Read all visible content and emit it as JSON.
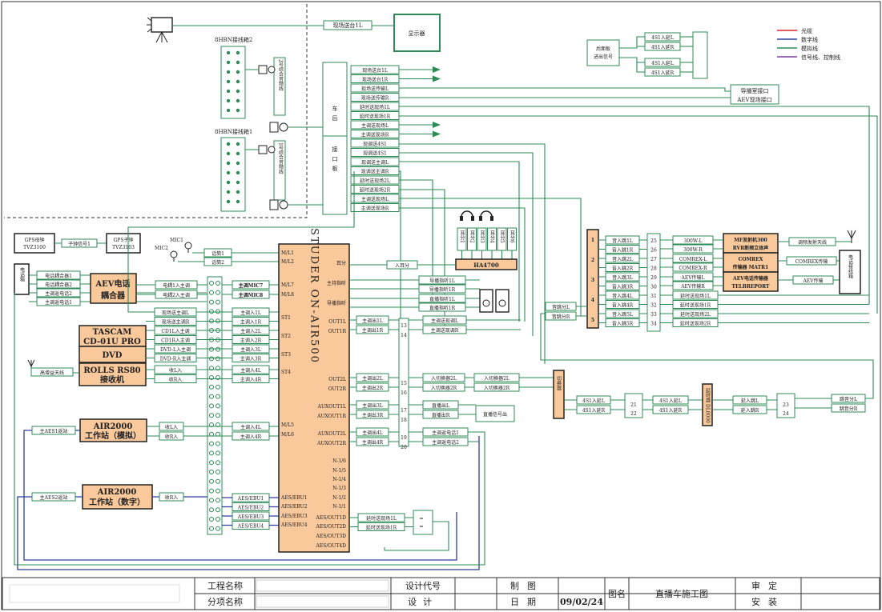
{
  "legend": [
    {
      "label": "光缆",
      "color": "#d62728"
    },
    {
      "label": "数字线",
      "color": "#2f3e9e"
    },
    {
      "label": "模拟线",
      "color": "#2e8b57"
    },
    {
      "label": "信号线、控制线",
      "color": "#7b3fa0"
    }
  ],
  "top": {
    "monitor_cable": "现场送台1L",
    "monitor": "显示器",
    "box2": "8HBN接线箱2",
    "box1": "8HBN接线箱1",
    "cable2": "2号综合音频线",
    "cable1": "1号综合音频线"
  },
  "rear_panel": {
    "title": "后面板进出信号",
    "labels": [
      "4S1入延L",
      "4S1入延R",
      "4S1入延L",
      "4S1入延R"
    ]
  },
  "panel": {
    "t1": "车",
    "t2": "后",
    "t3": "接",
    "t4": "口",
    "t5": "板",
    "rows": [
      "现场送台1L",
      "现场送台1R",
      "现场送传输L",
      "现场送传输R",
      "延时送现场1L",
      "延时送现场1R",
      "主调送现场L",
      "主调送现场R",
      "现调送4S1",
      "现调送4S1",
      "现调送主调L",
      "现调送主调R",
      "延时送现场2L",
      "延时送现场2R",
      "主调送现场L",
      "主调送现场R"
    ]
  },
  "guide": {
    "label1": "导播室接口",
    "label2": "AEV现场接口"
  },
  "gps": {
    "mother": "GPS母钟",
    "mother_model": "TVZ3100",
    "sub_signal": "子钟信号1",
    "child": "GPS子钟",
    "child_model": "TVZ3103"
  },
  "mics": {
    "mic1": "MIC1",
    "mic2": "MIC2",
    "label1": "话筒1",
    "label2": "话筒2"
  },
  "phone": {
    "box": "电话箱",
    "rows": [
      "电话耦合器1",
      "电话耦合器2",
      "主调返电话2",
      "主调返电话1"
    ]
  },
  "aev": {
    "l1": "AEV电话",
    "l2": "耦合器",
    "out1": "电耦1入主调",
    "out2": "电耦2入主调",
    "m1": "主调MIC7",
    "m2": "主调MIC8"
  },
  "sources": {
    "rows": [
      "现场送主调L",
      "现场送主调R",
      "CD1L入主调",
      "CD1R入主调",
      "DVD-L入主调",
      "DVD-R入主调",
      "收L入",
      "收R入"
    ],
    "mains": [
      "主调入1L",
      "主调入1R",
      "主调入2L",
      "主调入2R",
      "主调入3L",
      "主调入3R",
      "主调入4L",
      "主调入4R"
    ],
    "tascam1": "TASCAM",
    "tascam2": "CD-01U PRO",
    "dvd": "DVD",
    "rolls1": "ROLLS RS80",
    "rolls2": "接收机",
    "antenna": "高增益天线"
  },
  "air1": {
    "l1": "AIR2000",
    "l2": "工作站（模拟）",
    "in": "主AES1返站",
    "r1": "收L入",
    "r2": "收R入",
    "m1": "主调入4L",
    "m2": "主调入4R"
  },
  "air2": {
    "l1": "AIR2000",
    "l2": "工作站（数字）",
    "in": "主AES2返站",
    "r1": "收R入"
  },
  "aes": {
    "rows": [
      "AES/EBU1",
      "AES/EBU2",
      "AES/EBU3",
      "AES/EBU4"
    ]
  },
  "studer": {
    "title": "STUDER ON-AIR500",
    "left": [
      "M/L1",
      "M/L2",
      "M/L7",
      "M/L8",
      "ST1",
      "ST2",
      "ST3",
      "ST4",
      "M/L5",
      "M/L6",
      "AES/EBU1",
      "AES/EBU2",
      "AES/EBU3",
      "AES/EBU4"
    ],
    "right": [
      "耳分",
      "主持指听",
      "导播指听",
      "OUT1L",
      "OUT1R",
      "OUT2L",
      "OUT2R",
      "AUXOUT1L",
      "AUXOUT1R",
      "AUXOUT2L",
      "AUXOUT2R",
      "N-1/6",
      "N-1/5",
      "N-1/4",
      "N-1/3",
      "N-1/2",
      "N-1/1",
      "AES/OUT1D",
      "AES/OUT2D",
      "AES/OUT3D",
      "AES/OUT4D"
    ]
  },
  "hp": {
    "labels": [
      "耳分1",
      "耳分2",
      "耳分3",
      "耳分4",
      "耳分5",
      "耳分6"
    ],
    "amp": "HA4700",
    "in": "入耳分"
  },
  "listen": [
    "导播指听1L",
    "导播指听1R",
    "直播指听1L",
    "直播指听1R"
  ],
  "outs": {
    "o1": "主调出1L",
    "o2": "主调出1R",
    "o3": "主调出2L",
    "o4": "主调出2R",
    "o5": "主调出3L",
    "o6": "主调出3R",
    "o7": "主调出4L",
    "o8": "主调出4R",
    "s1": "主调送现调L",
    "s2": "主调送现调R",
    "c1": "入切换器2L",
    "c2": "入切换器2R",
    "c3": "入切换器2L",
    "c4": "入切换器2R",
    "d1": "直播出L",
    "d2": "直播出R",
    "direct": "直播信号出",
    "p1": "主调返电话1",
    "p2": "主调返电话2"
  },
  "delay_outs": [
    "延时送现场1L",
    "延时送现场1R"
  ],
  "switcher": {
    "label": "切换器",
    "o1": "4S1入延L",
    "o2": "4S1入延R",
    "o3": "4S1入延L",
    "o4": "4S1入延R"
  },
  "delay": {
    "label": "延时器 DL8000",
    "o1": "延入跳L",
    "o2": "延入跳R",
    "o3": "跳音分L",
    "o4": "跳音分R"
  },
  "dist": {
    "in1": "音跳分L",
    "in2": "音跳分R",
    "nums": [
      "1",
      "2",
      "3",
      "4",
      "5"
    ],
    "rows": [
      "音入跳1L",
      "音入跳1R",
      "音入跳2L",
      "音入跳2R",
      "音入跳3L",
      "音入跳3R",
      "音入跳4L",
      "音入跳4R",
      "音入跳5L",
      "音入跳5R"
    ],
    "nums2": [
      "25",
      "26",
      "27",
      "28",
      "29",
      "30",
      "31",
      "32",
      "33",
      "34"
    ]
  },
  "fm": {
    "r1": "300W-L",
    "r2": "300W-R",
    "box1": "MF发射机300",
    "box2": "RVR新频立体声",
    "out": "调频发射天线"
  },
  "comrex": {
    "r1": "COMREX-L",
    "r2": "COMREX-R",
    "box1": "COMREX",
    "box2": "传输器 MATR1",
    "out": "COMREX传输"
  },
  "aevtx": {
    "r1": "AEV传输L",
    "r2": "AEV传输R",
    "box1": "AEV电话传输器",
    "box2": "TELBREPORT",
    "out": "AEV传输"
  },
  "tel_box": "电话接线箱",
  "delay_rows": [
    "延时送现场1L",
    "延时送现场1R",
    "延时送现场2L",
    "延时送现场2R"
  ],
  "title_block": {
    "project": "工程名称",
    "sub": "分项名称",
    "code": "设计代号",
    "design": "设计",
    "draw": "制图",
    "date": "日期",
    "date_val": "09/02/24",
    "name_lbl": "图名",
    "name": "直播车施工图",
    "review": "审定",
    "install": "安装"
  }
}
